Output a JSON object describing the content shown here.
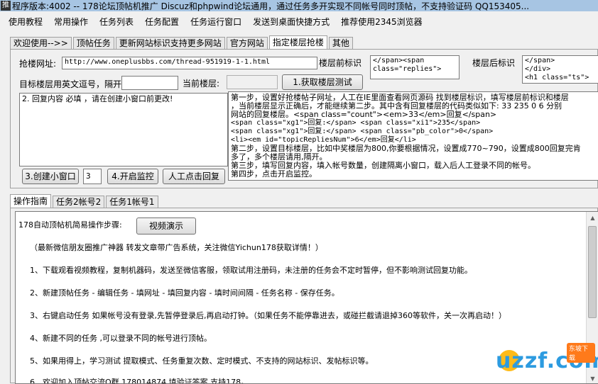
{
  "titlebar": {
    "title": "程序版本:4002 -- 178论坛顶帖机推广 Discuz和phpwind论坛通用，通过任务多开实现不同帐号同时顶帖，不支持验证码   QQ153405..."
  },
  "menu": [
    "使用教程",
    "常用操作",
    "任务列表",
    "任务配置",
    "任务运行窗口",
    "发送到桌面快捷方式",
    "推荐使用2345浏览器"
  ],
  "top_tabs": [
    {
      "label": "欢迎使用-->>",
      "active": false
    },
    {
      "label": "顶帖任务",
      "active": false
    },
    {
      "label": "更新网站标识支持更多网站",
      "active": false
    },
    {
      "label": "官方网站",
      "active": false
    },
    {
      "label": "指定楼层抢楼",
      "active": true
    },
    {
      "label": "其他",
      "active": false
    }
  ],
  "form": {
    "url_label": "抢楼网址:",
    "url_value": "http://www.oneplusbbs.com/thread-951919-1-1.html",
    "floor_prefix_label": "楼层前标识",
    "floor_prefix_value": "</span><span\nclass=\"replies\">",
    "floor_suffix_label": "楼层后标识",
    "floor_suffix_value": "</span>\n</div>\n<h1 class=\"ts\">",
    "target_floor_label": "目标楼层用英文逗号，隔开",
    "target_floor_value": "",
    "current_floor_label": "当前楼层:",
    "current_floor_value": "",
    "get_floor_btn": "1.获取楼层测试",
    "reply_text": "2. 回复内容 必填 ，请在创建小窗口前更改!",
    "create_window_btn": "3.创建小窗口",
    "window_count": "3",
    "start_monitor_btn": "4.开启监控",
    "manual_reply_btn": "人工点击回复"
  },
  "help_text": [
    "第一步，设置好抢楼帖子网址，人工在IE里面查看网页源码 找到楼层标识，填写楼层前标识和楼层",
    "，当前楼层显示正确后，才能继续第二步。其中含有回复楼层的代码类似如下: 33  235 0 6 分别",
    "网站的回复楼层。<span class=\"count\"><em>33</em>回复</span>",
    "<span class=\"xg1\">回复:</span> <span class=\"xi1\">235</span>",
    "<span class=\"xg1\">回复:</span> <span class=\"pb_color\">0</span>",
    "<li><em id=\"topicRepliesNum\">6</em>回复</li>",
    "第二步，设置目标楼层，比如中奖楼层为800,你要根据情况，设置成770~790，设置成800回复完肯",
    "多了，多个楼层请用,隔开。",
    "第三步，填写回复内容，填入帐号数量，创建隔离小窗口，载入后人工登录不同的帐号。",
    "第四步，点击开启监控。"
  ],
  "bottom_tabs": [
    {
      "label": "操作指南",
      "active": true
    },
    {
      "label": "任务2帐号2",
      "active": false
    },
    {
      "label": "任务1帐号1",
      "active": false
    }
  ],
  "guide": {
    "heading": "178自动顶帖机简易操作步骤:",
    "video_btn": "视频演示",
    "notice": "（最新微信朋友圈推广神器 转发文章带广告系统，关注微信Yichun178获取详情！）",
    "items": [
      "1、下载观看视频教程，复制机器码，发送至微信客服，领取试用注册码，未注册的任务会不定时暂停，但不影响测试回复功能。",
      "2、新建顶帖任务 - 编辑任务 - 填网址 - 填回复内容 - 填时间间隔 - 任务名称 - 保存任务。",
      "3、右键启动任务 如果帐号没有登录,先暂停登录后,再启动打钟。（如果任务不能停靠进去，或碰拦截请退掉360等软件，关一次再启动！）",
      "4、新建不同的任务 ,可以登录不同的帐号进行顶帖。",
      "5、如果用得上，学习测试 提取模式、任务重复次数、定时模式、不支持的网站标识、发帖标识等。",
      "6、欢迎加入顶帖交流Q群 178014874 填验证答案 支持178。"
    ]
  },
  "watermark": {
    "logo_text": "uzzf.com",
    "badge": "东坡下载"
  }
}
